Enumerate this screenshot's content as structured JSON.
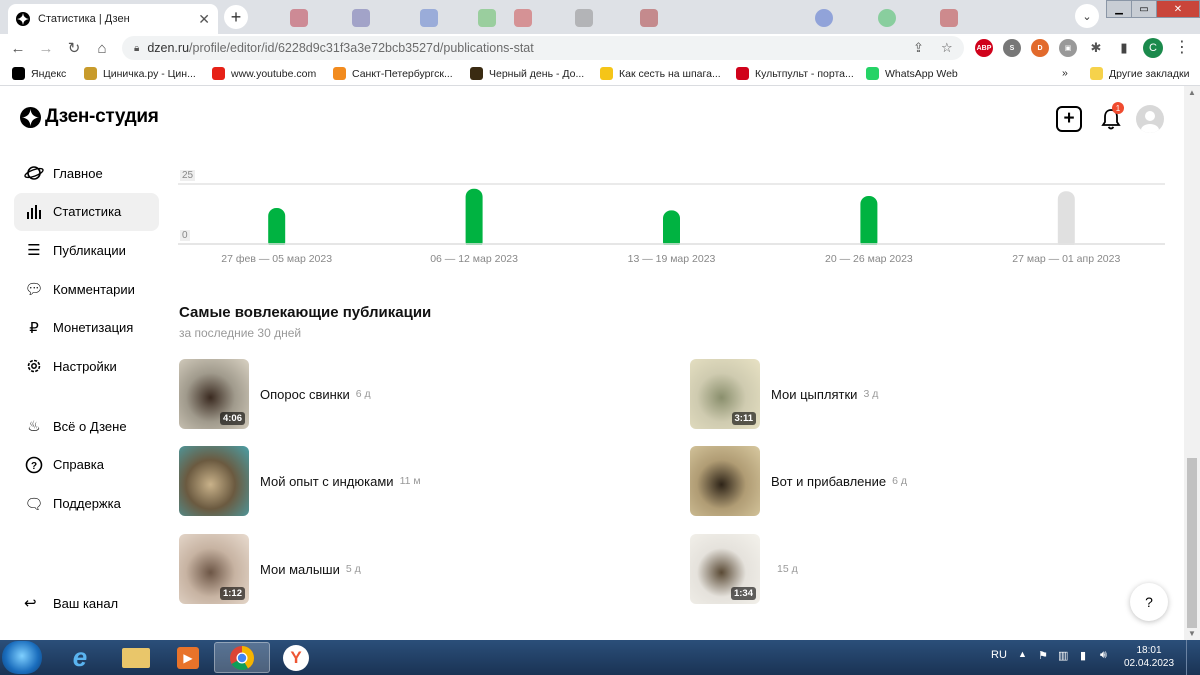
{
  "browser": {
    "tab_title": "Статистика | Дзен",
    "url_domain": "dzen.ru",
    "url_path": "/profile/editor/id/6228d9c31f3a3e72bcb3527d/publications-stat",
    "bookmarks": [
      {
        "label": "Яндекс",
        "color": "#000000"
      },
      {
        "label": "Циничка.ру - Цин...",
        "color": "#c89b2b"
      },
      {
        "label": "www.youtube.com",
        "color": "#e62117"
      },
      {
        "label": "Санкт-Петербургск...",
        "color": "#f28b1e"
      },
      {
        "label": "Черный день - До...",
        "color": "#3a2b12"
      },
      {
        "label": "Как сесть на шпага...",
        "color": "#f5c518"
      },
      {
        "label": "Культпульт - порта...",
        "color": "#d0021b"
      },
      {
        "label": "WhatsApp Web",
        "color": "#25d366"
      }
    ],
    "bookmarks_more": "»",
    "other_bookmarks": "Другие закладки",
    "profile_letter": "С",
    "ext_abp": "ABP"
  },
  "app": {
    "logo": "Дзен-студия",
    "notifications_count": "1",
    "nav": [
      {
        "label": "Главное",
        "icon": "planet-icon"
      },
      {
        "label": "Статистика",
        "icon": "bar-chart-icon"
      },
      {
        "label": "Публикации",
        "icon": "stack-icon"
      },
      {
        "label": "Комментарии",
        "icon": "comment-icon"
      },
      {
        "label": "Монетизация",
        "icon": "ruble-icon"
      },
      {
        "label": "Настройки",
        "icon": "gear-icon"
      }
    ],
    "nav2": [
      {
        "label": "Всё о Дзене",
        "icon": "flame-icon"
      },
      {
        "label": "Справка",
        "icon": "question-icon"
      },
      {
        "label": "Поддержка",
        "icon": "support-icon"
      }
    ],
    "channel": "Ваш канал",
    "help": "?"
  },
  "chart_data": {
    "type": "bar",
    "categories": [
      "27 фев — 05 мар 2023",
      "06 — 12 мар 2023",
      "13 — 19 мар 2023",
      "20 — 26 мар 2023",
      "27 мар — 01 апр 2023"
    ],
    "values": [
      15,
      23,
      14,
      20,
      22
    ],
    "ylim": [
      0,
      25
    ],
    "yticks": [
      "25",
      "0"
    ],
    "bar_colors": [
      "#00b341",
      "#00b341",
      "#00b341",
      "#00b341",
      "#e0e0e0"
    ],
    "grid": true
  },
  "section": {
    "title": "Самые вовлекающие публикации",
    "subtitle": "за последние 30 дней"
  },
  "publications": [
    {
      "title": "Опорос свинки",
      "age": "6 д",
      "duration": "4:06",
      "colors": [
        "#a09a8c",
        "#3a2a20",
        "#d9d2c3"
      ]
    },
    {
      "title": "Мои цыплятки",
      "age": "3 д",
      "duration": "3:11",
      "colors": [
        "#cfcbb0",
        "#8a8f6d",
        "#e8e2c4"
      ]
    },
    {
      "title": "Мой опыт с индюками",
      "age": "11 м",
      "duration": "",
      "colors": [
        "#6b5a40",
        "#c9b28a",
        "#4aa0a8"
      ]
    },
    {
      "title": "Вот и прибавление",
      "age": "6 д",
      "duration": "",
      "colors": [
        "#b09c74",
        "#2e2418",
        "#d8c9a0"
      ]
    },
    {
      "title": "Мои малыши",
      "age": "5 д",
      "duration": "1:12",
      "colors": [
        "#c7b3a2",
        "#6d5646",
        "#e9dcd0"
      ]
    },
    {
      "title": "",
      "age": "15 д",
      "duration": "1:34",
      "colors": [
        "#e5e2dc",
        "#5a4a35",
        "#f4f2ec"
      ]
    }
  ],
  "taskbar": {
    "lang": "RU",
    "time": "18:01",
    "date": "02.04.2023"
  }
}
